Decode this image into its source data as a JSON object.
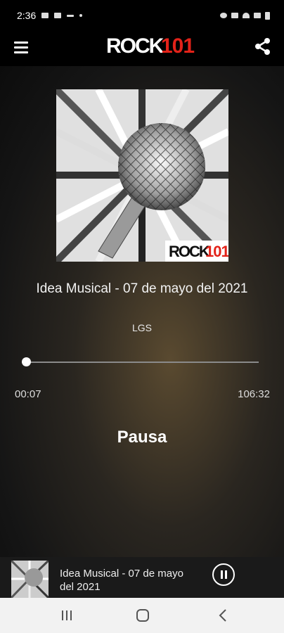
{
  "status_bar": {
    "time": "2:36"
  },
  "app": {
    "logo_text": "ROCK101"
  },
  "player": {
    "track_title": "Idea Musical - 07 de mayo del 2021",
    "artist": "LGS",
    "elapsed": "00:07",
    "total": "106:32",
    "progress_fraction": 0.001,
    "action_label": "Pausa",
    "art_logo_text": "ROCK101"
  },
  "mini_player": {
    "title": "Idea Musical - 07 de mayo del 2021"
  },
  "icons": {
    "menu": "hamburger-menu-icon",
    "share": "share-icon",
    "pause": "pause-circle-icon",
    "nav_recents": "recents-icon",
    "nav_home": "home-icon",
    "nav_back": "back-icon"
  },
  "colors": {
    "logo_red": "#e32219",
    "background": "#000000"
  }
}
